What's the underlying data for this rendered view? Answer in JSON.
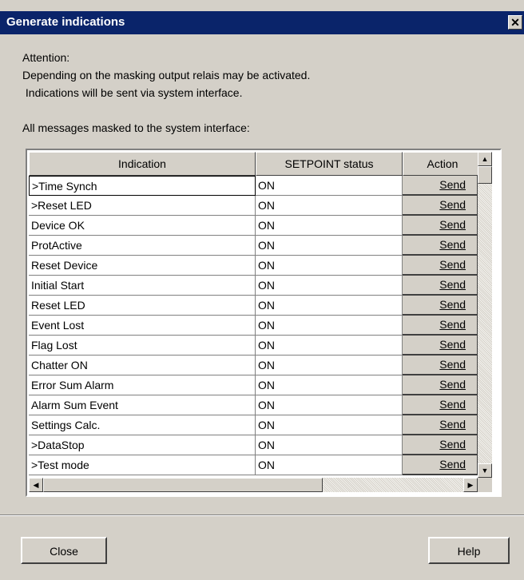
{
  "window": {
    "title": "Generate indications",
    "close_glyph": "✕"
  },
  "attention": {
    "line1": "Attention:",
    "line2": "Depending on the masking output relais may be activated.",
    "line3": " Indications will be sent via system interface."
  },
  "list_caption": "All messages masked to the system interface:",
  "table": {
    "columns": [
      "Indication",
      "SETPOINT status",
      "Action"
    ],
    "rows": [
      {
        "indication": ">Time Synch",
        "status": "ON",
        "action": "Send"
      },
      {
        "indication": ">Reset LED",
        "status": "ON",
        "action": "Send"
      },
      {
        "indication": "Device OK",
        "status": "ON",
        "action": "Send"
      },
      {
        "indication": "ProtActive",
        "status": "ON",
        "action": "Send"
      },
      {
        "indication": "Reset Device",
        "status": "ON",
        "action": "Send"
      },
      {
        "indication": "Initial Start",
        "status": "ON",
        "action": "Send"
      },
      {
        "indication": "Reset LED",
        "status": "ON",
        "action": "Send"
      },
      {
        "indication": "Event Lost",
        "status": "ON",
        "action": "Send"
      },
      {
        "indication": "Flag Lost",
        "status": "ON",
        "action": "Send"
      },
      {
        "indication": "Chatter ON",
        "status": "ON",
        "action": "Send"
      },
      {
        "indication": "Error Sum Alarm",
        "status": "ON",
        "action": "Send"
      },
      {
        "indication": "Alarm Sum Event",
        "status": "ON",
        "action": "Send"
      },
      {
        "indication": "Settings Calc.",
        "status": "ON",
        "action": "Send"
      },
      {
        "indication": ">DataStop",
        "status": "ON",
        "action": "Send"
      },
      {
        "indication": ">Test mode",
        "status": "ON",
        "action": "Send"
      }
    ]
  },
  "buttons": {
    "close": "Close",
    "help": "Help"
  },
  "icons": {
    "scroll_up": "▲",
    "scroll_down": "▼",
    "scroll_left": "◀",
    "scroll_right": "▶"
  },
  "colors": {
    "titlebar": "#0a246a",
    "face": "#d4d0c8"
  }
}
